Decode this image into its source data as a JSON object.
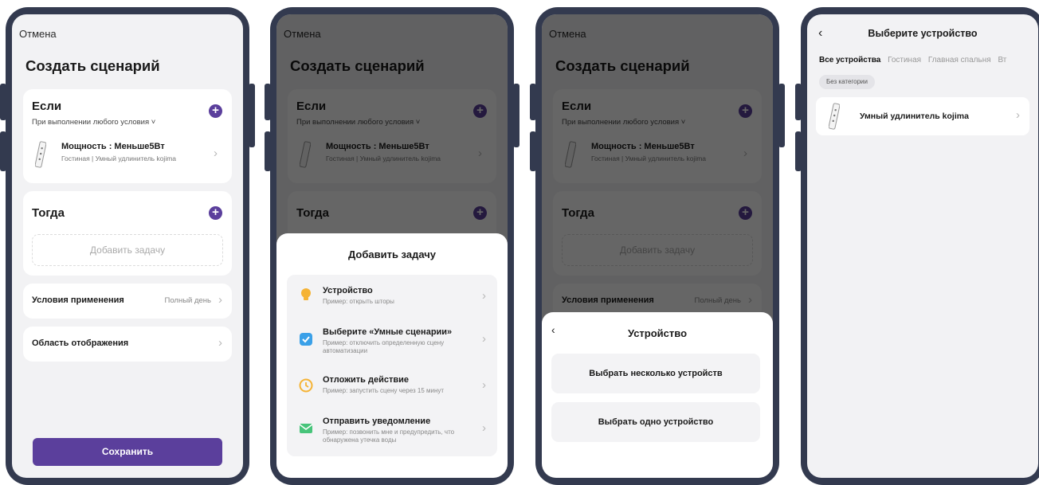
{
  "screen1": {
    "cancel": "Отмена",
    "title": "Создать сценарий",
    "if_section": {
      "heading": "Если",
      "subtitle": "При выполнении любого условия ˅",
      "condition_name": "Мощность : Меньше5Вт",
      "condition_sub": "Гостиная | Умный удлинитель kojima"
    },
    "then_section": {
      "heading": "Тогда",
      "add_task": "Добавить задачу"
    },
    "conditions_row": {
      "label": "Условия применения",
      "value": "Полный день"
    },
    "display_row": {
      "label": "Область отображения"
    },
    "save": "Сохранить"
  },
  "screen2": {
    "sheet_title": "Добавить задачу",
    "tasks": [
      {
        "name": "Устройство",
        "sub": "Пример: открыть шторы",
        "icon": "lightbulb-icon"
      },
      {
        "name": "Выберите «Умные сценарии»",
        "sub": "Пример: отключить определенную сцену автоматизации",
        "icon": "checkbox-icon"
      },
      {
        "name": "Отложить действие",
        "sub": "Пример: запустить сцену через 15 минут",
        "icon": "clock-icon"
      },
      {
        "name": "Отправить уведомление",
        "sub": "Пример: позвонить мне и предупредить, что обнаружена утечка воды",
        "icon": "envelope-icon"
      }
    ]
  },
  "screen3": {
    "sheet_title": "Устройство",
    "options": [
      "Выбрать несколько устройств",
      "Выбрать одно устройство"
    ]
  },
  "screen4": {
    "title": "Выберите устройство",
    "tabs": [
      "Все устройства",
      "Гостиная",
      "Главная спальня",
      "Вт"
    ],
    "chip": "Без категории",
    "device": "Умный удлинитель kojima"
  },
  "colors": {
    "accent": "#5b3f9c",
    "phone_frame": "#333a4f",
    "background": "#f2f2f4"
  }
}
